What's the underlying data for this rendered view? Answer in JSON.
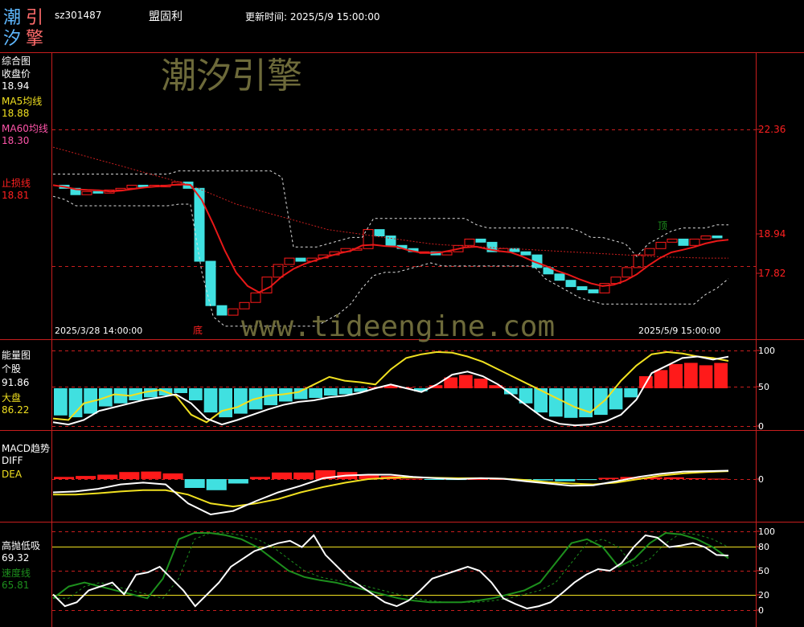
{
  "app": {
    "logo_chars": [
      "潮",
      "引",
      "汐",
      "擎"
    ],
    "stock_code": "sz301487",
    "stock_name": "盟固利",
    "update_label": "更新时间: 2025/5/9 15:00:00"
  },
  "watermark": {
    "brand": "潮汐引擎",
    "url": "www.tideengine.com"
  },
  "colors": {
    "background": "#000000",
    "grid_red": "#c81e1e",
    "close_line": "#e81818",
    "cyan_bar": "#40e0e0",
    "red_bar": "#ff1a1a",
    "yellow": "#f0e020",
    "white": "#ffffff",
    "green": "#1d8f1d",
    "ma60": "#ff55aa"
  },
  "panels": {
    "main": {
      "title": "综合图",
      "close_label": "收盘价",
      "close_value": "18.94",
      "ma5_label": "MA5均线",
      "ma5_value": "18.88",
      "ma60_label": "MA60均线",
      "ma60_value": "18.30",
      "stop_label": "止损线",
      "stop_value": "18.81",
      "price_ticks": [
        "22.36",
        "18.94",
        "17.82"
      ],
      "date_start": "2025/3/28 14:00:00",
      "date_end": "2025/5/9 15:00:00",
      "bottom_marker": "底",
      "top_marker": "顶"
    },
    "energy": {
      "title": "能量图",
      "stock_label": "个股",
      "stock_value": "91.86",
      "market_label": "大盘",
      "market_value": "86.22",
      "ticks": [
        "100",
        "50",
        "0"
      ]
    },
    "macd": {
      "title": "MACD趋势",
      "diff_label": "DIFF",
      "dea_label": "DEA",
      "ticks": [
        "0"
      ]
    },
    "hl": {
      "title": "高抛低吸",
      "value1": "69.32",
      "speed_label": "速度线",
      "speed_value": "65.81",
      "ticks": [
        "100",
        "80",
        "50",
        "20",
        "0"
      ]
    }
  },
  "chart_data": [
    {
      "type": "line",
      "title": "综合图",
      "series": [
        {
          "name": "收盘价",
          "values": [
            20.6,
            20.5,
            20.3,
            20.4,
            20.35,
            20.45,
            20.5,
            20.6,
            20.55,
            20.6,
            20.6,
            20.7,
            20.5,
            18.2,
            16.8,
            16.5,
            16.7,
            16.9,
            17.2,
            17.7,
            18.1,
            18.3,
            18.2,
            18.3,
            18.4,
            18.5,
            18.6,
            18.6,
            19.2,
            19.0,
            18.7,
            18.6,
            18.5,
            18.5,
            18.4,
            18.5,
            18.7,
            18.9,
            18.8,
            18.5,
            18.6,
            18.5,
            18.4,
            18.0,
            17.8,
            17.6,
            17.4,
            17.3,
            17.2,
            17.5,
            17.7,
            18.0,
            18.4,
            18.6,
            18.8,
            18.9,
            18.7,
            18.9,
            19.0,
            18.94
          ]
        },
        {
          "name": "MA5均线",
          "values": [
            20.6,
            20.55,
            20.47,
            20.45,
            20.44,
            20.4,
            20.43,
            20.48,
            20.53,
            20.56,
            20.59,
            20.63,
            20.61,
            20.13,
            19.37,
            18.54,
            17.84,
            17.42,
            17.22,
            17.4,
            17.72,
            17.96,
            18.12,
            18.24,
            18.35,
            18.45,
            18.53,
            18.7,
            18.72,
            18.68,
            18.66,
            18.55,
            18.48,
            18.46,
            18.49,
            18.56,
            18.64,
            18.66,
            18.58,
            18.52,
            18.48,
            18.35,
            18.19,
            18.06,
            17.9,
            17.78,
            17.63,
            17.5,
            17.42,
            17.46,
            17.59,
            17.79,
            18.06,
            18.3,
            18.48,
            18.56,
            18.65,
            18.76,
            18.84,
            18.88
          ]
        },
        {
          "name": "MA60均线",
          "values": [
            21.8,
            21.7,
            21.6,
            21.5,
            21.4,
            21.3,
            21.2,
            21.1,
            21.0,
            20.9,
            20.8,
            20.7,
            20.6,
            20.45,
            20.3,
            20.15,
            20.0,
            19.9,
            19.8,
            19.7,
            19.6,
            19.5,
            19.4,
            19.3,
            19.2,
            19.15,
            19.1,
            19.05,
            19.0,
            18.95,
            18.9,
            18.85,
            18.8,
            18.75,
            18.72,
            18.7,
            18.68,
            18.66,
            18.64,
            18.62,
            18.6,
            18.58,
            18.56,
            18.54,
            18.52,
            18.5,
            18.48,
            18.46,
            18.44,
            18.42,
            18.4,
            18.38,
            18.36,
            18.34,
            18.33,
            18.32,
            18.31,
            18.3,
            18.3,
            18.3
          ]
        }
      ]
    },
    {
      "type": "line",
      "title": "能量图",
      "ylim": [
        0,
        100
      ],
      "series": [
        {
          "name": "个股",
          "values": [
            5,
            2,
            8,
            20,
            25,
            30,
            35,
            38,
            42,
            30,
            10,
            2,
            8,
            15,
            22,
            28,
            32,
            34,
            38,
            40,
            44,
            50,
            55,
            50,
            45,
            55,
            68,
            72,
            66,
            55,
            40,
            25,
            10,
            3,
            1,
            2,
            6,
            15,
            35,
            70,
            80,
            90,
            92,
            88,
            91.86
          ]
        },
        {
          "name": "大盘",
          "values": [
            10,
            8,
            30,
            35,
            42,
            40,
            45,
            48,
            40,
            15,
            5,
            20,
            25,
            35,
            40,
            42,
            45,
            55,
            65,
            60,
            58,
            55,
            75,
            90,
            95,
            98,
            97,
            92,
            85,
            75,
            65,
            55,
            45,
            35,
            25,
            18,
            35,
            60,
            80,
            95,
            98,
            96,
            92,
            90,
            86.22
          ]
        }
      ]
    },
    {
      "type": "line",
      "title": "MACD趋势",
      "series": [
        {
          "name": "DIFF",
          "values": [
            -0.3,
            -0.28,
            -0.22,
            -0.12,
            -0.08,
            -0.12,
            -0.55,
            -0.8,
            -0.72,
            -0.5,
            -0.3,
            -0.15,
            0.02,
            0.08,
            0.1,
            0.1,
            0.05,
            0.02,
            0.0,
            0.02,
            0.01,
            -0.05,
            -0.1,
            -0.15,
            -0.14,
            -0.05,
            0.05,
            0.12,
            0.17,
            0.18,
            0.19
          ]
        },
        {
          "name": "DEA",
          "values": [
            -0.35,
            -0.35,
            -0.32,
            -0.28,
            -0.25,
            -0.25,
            -0.35,
            -0.55,
            -0.62,
            -0.55,
            -0.45,
            -0.3,
            -0.18,
            -0.08,
            0.0,
            0.03,
            0.04,
            0.03,
            0.02,
            0.02,
            0.01,
            -0.02,
            -0.07,
            -0.1,
            -0.12,
            -0.08,
            0.0,
            0.08,
            0.13,
            0.16,
            0.18
          ]
        }
      ]
    },
    {
      "type": "line",
      "title": "高抛低吸",
      "ylim": [
        0,
        100
      ],
      "series": [
        {
          "name": "高抛低吸",
          "values": [
            20,
            5,
            10,
            25,
            30,
            35,
            20,
            45,
            48,
            55,
            40,
            25,
            5,
            20,
            35,
            55,
            65,
            75,
            80,
            85,
            88,
            80,
            95,
            70,
            55,
            40,
            30,
            20,
            10,
            5,
            12,
            25,
            40,
            45,
            50,
            55,
            50,
            35,
            15,
            8,
            2,
            5,
            10,
            22,
            35,
            45,
            52,
            50,
            60,
            80,
            95,
            92,
            80,
            82,
            85,
            80,
            70,
            69.32
          ]
        },
        {
          "name": "速度线",
          "values": [
            15,
            30,
            35,
            30,
            25,
            20,
            15,
            40,
            90,
            98,
            98,
            95,
            90,
            80,
            65,
            50,
            42,
            38,
            35,
            30,
            25,
            20,
            15,
            12,
            10,
            10,
            10,
            12,
            15,
            20,
            25,
            35,
            60,
            85,
            90,
            80,
            55,
            65,
            85,
            98,
            96,
            90,
            80,
            65.81
          ]
        }
      ]
    }
  ]
}
